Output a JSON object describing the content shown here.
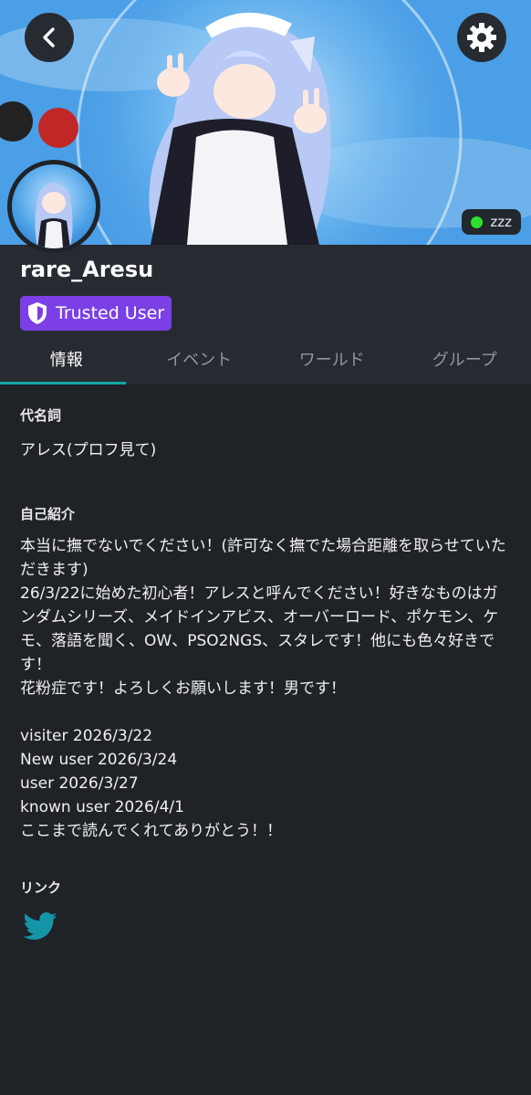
{
  "header": {
    "back_icon": "chevron-left-icon",
    "settings_icon": "gear-icon",
    "status_text": "zzz",
    "status_color": "#2ee02e"
  },
  "profile": {
    "username": "rare_Aresu",
    "trust_badge": "Trusted User",
    "trust_badge_color": "#7c3fe6",
    "trust_icon": "shield-icon"
  },
  "tabs": [
    {
      "label": "情報",
      "active": true
    },
    {
      "label": "イベント",
      "active": false
    },
    {
      "label": "ワールド",
      "active": false
    },
    {
      "label": "グループ",
      "active": false
    }
  ],
  "pronouns": {
    "title": "代名詞",
    "value": "アレス(プロフ見て)"
  },
  "bio": {
    "title": "自己紹介",
    "text": "本当に撫でないでください！(許可なく撫でた場合距離を取らせていただきます)\n26/3/22に始めた初心者！アレスと呼んでください！好きなものはガンダムシリーズ、メイドインアビス、オーバーロード、ポケモン、ケモ、落語を聞く、OW、PSO2NGS、スタレです！他にも色々好きです！\n花粉症です！よろしくお願いします！男です！\n\nvisiter 2026/3/22\nNew user 2026/3/24\nuser 2026/3/27\nknown user 2026/4/1\nここまで読んでくれてありがとう！！"
  },
  "links": {
    "title": "リンク",
    "items": [
      {
        "icon": "twitter-icon",
        "color": "#1596a8"
      }
    ]
  },
  "accent_color": "#14a7a4"
}
